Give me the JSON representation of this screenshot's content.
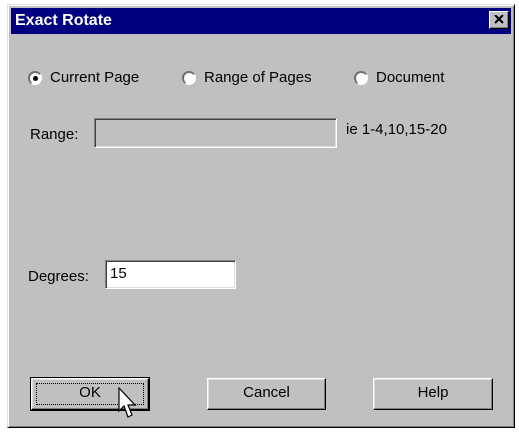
{
  "window": {
    "title": "Exact Rotate"
  },
  "scope": {
    "options": [
      {
        "label": "Current Page",
        "checked": true
      },
      {
        "label": "Range of Pages",
        "checked": false
      },
      {
        "label": "Document",
        "checked": false
      }
    ]
  },
  "range": {
    "label": "Range:",
    "value": "",
    "hint": "ie 1-4,10,15-20"
  },
  "degrees": {
    "label": "Degrees:",
    "value": "15"
  },
  "buttons": {
    "ok": "OK",
    "cancel": "Cancel",
    "help": "Help"
  },
  "colors": {
    "titlebar": "#000080",
    "face": "#c0c0c0"
  },
  "icons": {
    "close": "close-icon",
    "cursor": "mouse-pointer-icon"
  }
}
